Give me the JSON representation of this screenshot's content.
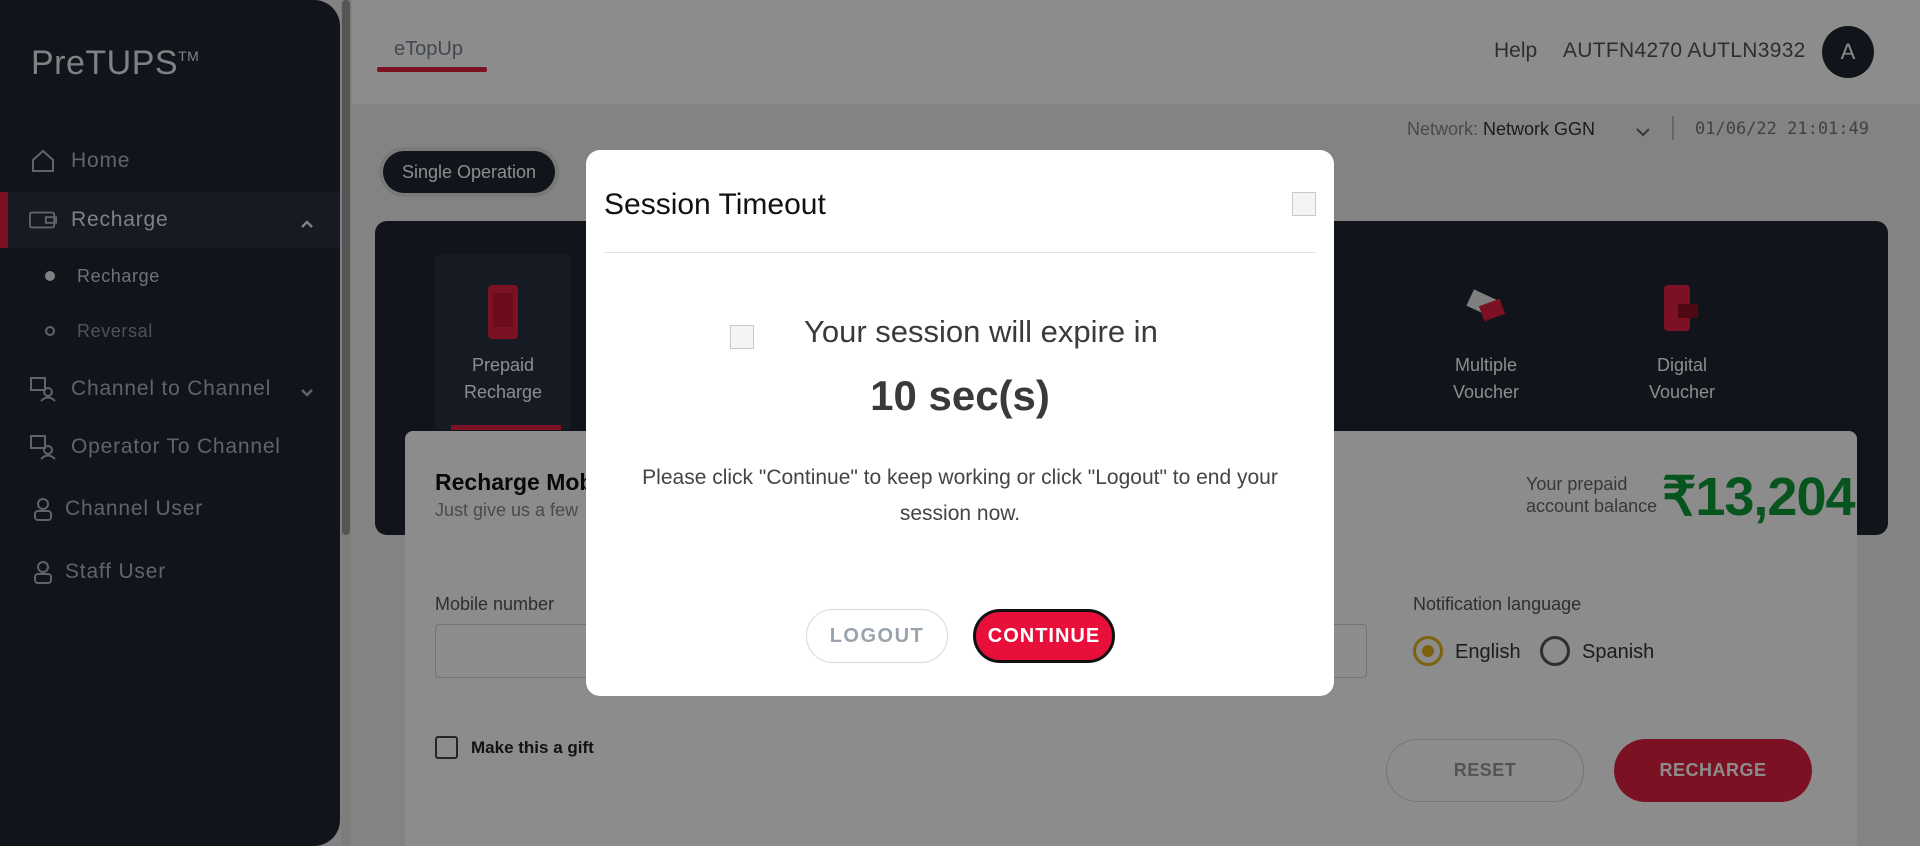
{
  "app": {
    "logo": "PreTUPS",
    "logo_mark": "TM"
  },
  "sidebar": {
    "items": [
      {
        "label": "Home",
        "icon": "home-icon"
      },
      {
        "label": "Recharge",
        "icon": "recharge-card-icon",
        "active": true,
        "expanded": true
      },
      {
        "label": "Channel to Channel",
        "icon": "channel-transfer-icon"
      },
      {
        "label": "Operator To Channel",
        "icon": "operator-transfer-icon"
      },
      {
        "label": "Channel User",
        "icon": "user-icon"
      },
      {
        "label": "Staff User",
        "icon": "user-icon"
      }
    ],
    "recharge_sub": [
      {
        "label": "Recharge",
        "selected": true
      },
      {
        "label": "Reversal",
        "selected": false
      }
    ]
  },
  "header": {
    "tab": "eTopUp",
    "help": "Help",
    "username": "AUTFN4270 AUTLN3932",
    "avatar_initial": "A"
  },
  "network": {
    "label": "Network:",
    "value": "Network GGN",
    "datetime": "01/06/22 21:01:49"
  },
  "operation_mode": "Single Operation",
  "operations": [
    {
      "line1": "Prepaid",
      "line2": "Recharge",
      "icon": "mobile-phone-icon",
      "active": true
    },
    {
      "line1": "Multiple",
      "line2": "Voucher",
      "icon": "multiple-voucher-icon"
    },
    {
      "line1": "Digital",
      "line2": "Voucher",
      "icon": "digital-voucher-icon"
    }
  ],
  "form": {
    "title": "Recharge Mob",
    "subtitle": "Just give us a few",
    "balance_label_1": "Your prepaid",
    "balance_label_2": "account balance",
    "balance_value": "₹13,204",
    "mobile_label": "Mobile number",
    "notification_label": "Notification language",
    "languages": [
      "English",
      "Spanish"
    ],
    "selected_language": "English",
    "gift_label": "Make this a gift",
    "reset": "RESET",
    "recharge": "RECHARGE"
  },
  "modal": {
    "title": "Session Timeout",
    "headline": "Your session will expire in",
    "countdown": "10 sec(s)",
    "body": "Please click \"Continue\" to keep working or click \"Logout\" to end your session now.",
    "logout": "LOGOUT",
    "continue": "CONTINUE"
  },
  "colors": {
    "accent": "#e0203f",
    "sidebar": "#1f2632",
    "balance": "#0e9a3a",
    "radio_selected": "#e3b21a"
  }
}
